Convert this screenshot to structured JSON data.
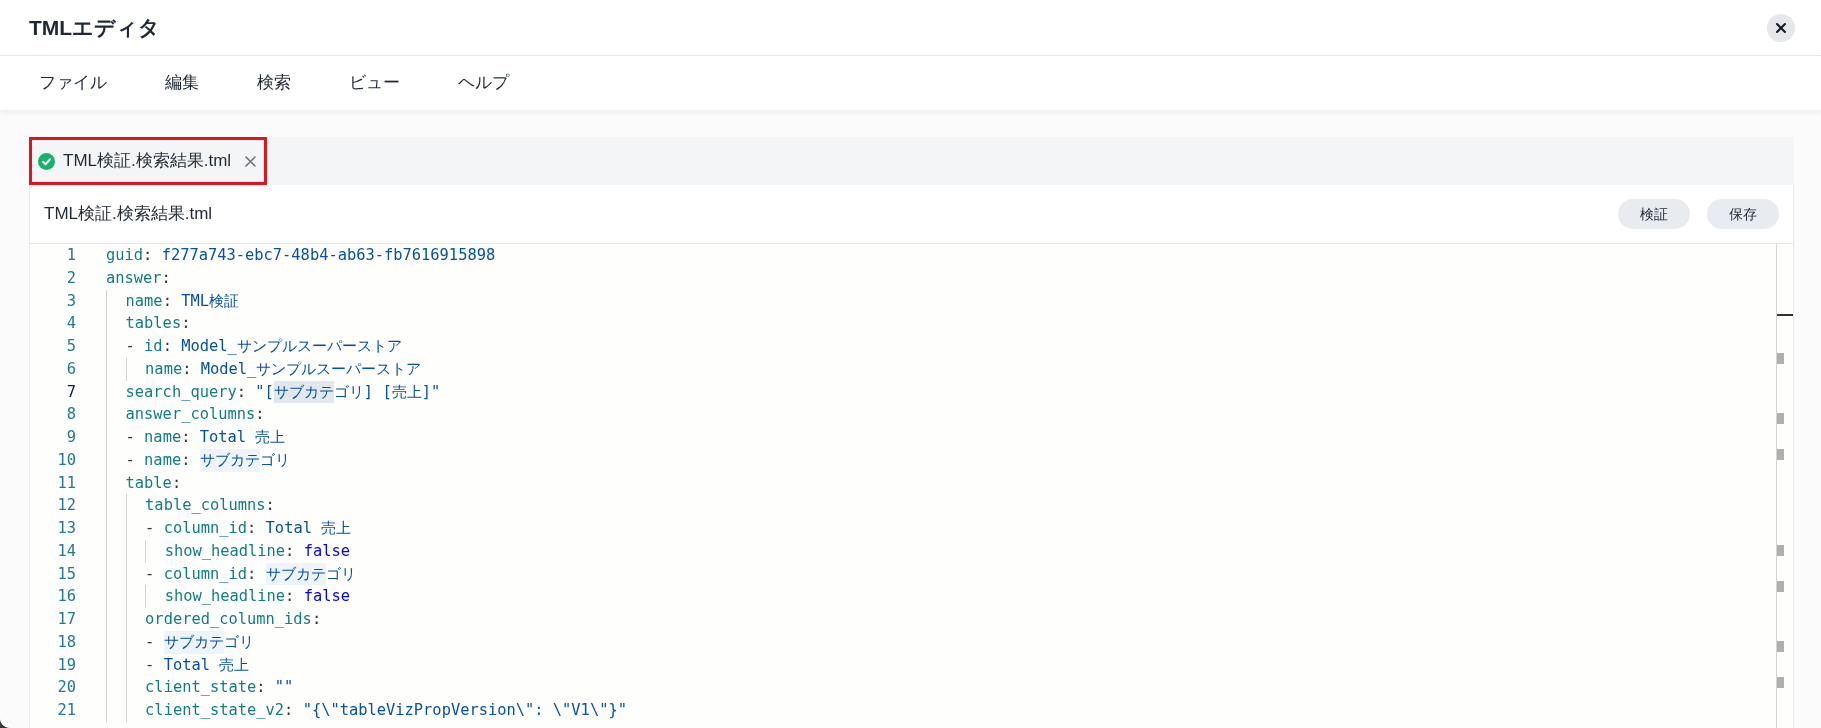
{
  "window": {
    "title": "TMLエディタ"
  },
  "menu": [
    {
      "label": "ファイル"
    },
    {
      "label": "編集"
    },
    {
      "label": "検索"
    },
    {
      "label": "ビュー"
    },
    {
      "label": "ヘルプ"
    }
  ],
  "tabs": [
    {
      "label": "TML検証.検索結果.tml",
      "valid": true,
      "selected": true,
      "outlined": true
    }
  ],
  "editor": {
    "file_name": "TML検証.検索結果.tml",
    "buttons": [
      "検証",
      "保存"
    ],
    "lines": [
      {
        "number": "1",
        "current": false,
        "parts": [
          {
            "kind": "key",
            "text": "guid"
          },
          {
            "kind": "punct",
            "text": ": "
          },
          {
            "kind": "value",
            "text": "f277a743-ebc7-48b4-ab63-fb7616915898"
          }
        ]
      },
      {
        "number": "2",
        "current": false,
        "parts": [
          {
            "kind": "key",
            "text": "answer"
          },
          {
            "kind": "punct",
            "text": ":"
          }
        ]
      },
      {
        "number": "3",
        "current": false,
        "parts": [
          {
            "kind": "key",
            "text": "  name"
          },
          {
            "kind": "punct",
            "text": ": "
          },
          {
            "kind": "value",
            "text": "TML検証"
          }
        ]
      },
      {
        "number": "4",
        "current": false,
        "parts": [
          {
            "kind": "key",
            "text": "  tables"
          },
          {
            "kind": "punct",
            "text": ":"
          }
        ]
      },
      {
        "number": "5",
        "current": false,
        "parts": [
          {
            "kind": "punct",
            "text": "  - "
          },
          {
            "kind": "key",
            "text": "id"
          },
          {
            "kind": "punct",
            "text": ": "
          },
          {
            "kind": "value",
            "text": "Model_サンプルスーパーストア"
          }
        ]
      },
      {
        "number": "6",
        "current": false,
        "parts": [
          {
            "kind": "key",
            "text": "    name"
          },
          {
            "kind": "punct",
            "text": ": "
          },
          {
            "kind": "value",
            "text": "Model_サンプルスーパーストア"
          }
        ]
      },
      {
        "number": "7",
        "current": true,
        "parts": [
          {
            "kind": "key",
            "text": "  search_query"
          },
          {
            "kind": "punct",
            "text": ": "
          },
          {
            "kind": "value",
            "text": "\"["
          },
          {
            "kind": "value",
            "text": "サブカテ",
            "highlighted": true,
            "current": true
          },
          {
            "kind": "value",
            "text": "ゴリ] [売上]\""
          }
        ]
      },
      {
        "number": "8",
        "current": false,
        "parts": [
          {
            "kind": "key",
            "text": "  answer_columns"
          },
          {
            "kind": "punct",
            "text": ":"
          }
        ]
      },
      {
        "number": "9",
        "current": false,
        "parts": [
          {
            "kind": "punct",
            "text": "  - "
          },
          {
            "kind": "key",
            "text": "name"
          },
          {
            "kind": "punct",
            "text": ": "
          },
          {
            "kind": "value",
            "text": "Total 売上"
          }
        ]
      },
      {
        "number": "10",
        "current": false,
        "parts": [
          {
            "kind": "punct",
            "text": "  - "
          },
          {
            "kind": "key",
            "text": "name"
          },
          {
            "kind": "punct",
            "text": ": "
          },
          {
            "kind": "value",
            "text": "サブカテ",
            "highlighted": true,
            "current": false
          },
          {
            "kind": "value",
            "text": "ゴリ"
          }
        ]
      },
      {
        "number": "11",
        "current": false,
        "parts": [
          {
            "kind": "key",
            "text": "  table"
          },
          {
            "kind": "punct",
            "text": ":"
          }
        ]
      },
      {
        "number": "12",
        "current": false,
        "parts": [
          {
            "kind": "key",
            "text": "    table_columns"
          },
          {
            "kind": "punct",
            "text": ":"
          }
        ]
      },
      {
        "number": "13",
        "current": false,
        "parts": [
          {
            "kind": "punct",
            "text": "    - "
          },
          {
            "kind": "key",
            "text": "column_id"
          },
          {
            "kind": "punct",
            "text": ": "
          },
          {
            "kind": "value",
            "text": "Total 売上"
          }
        ]
      },
      {
        "number": "14",
        "current": false,
        "parts": [
          {
            "kind": "key",
            "text": "      show_headline"
          },
          {
            "kind": "punct",
            "text": ": "
          },
          {
            "kind": "keyword",
            "text": "false"
          }
        ]
      },
      {
        "number": "15",
        "current": false,
        "parts": [
          {
            "kind": "punct",
            "text": "    - "
          },
          {
            "kind": "key",
            "text": "column_id"
          },
          {
            "kind": "punct",
            "text": ": "
          },
          {
            "kind": "value",
            "text": "サブカテ",
            "highlighted": true,
            "current": false
          },
          {
            "kind": "value",
            "text": "ゴリ"
          }
        ]
      },
      {
        "number": "16",
        "current": false,
        "parts": [
          {
            "kind": "key",
            "text": "      show_headline"
          },
          {
            "kind": "punct",
            "text": ": "
          },
          {
            "kind": "keyword",
            "text": "false"
          }
        ]
      },
      {
        "number": "17",
        "current": false,
        "parts": [
          {
            "kind": "key",
            "text": "    ordered_column_ids"
          },
          {
            "kind": "punct",
            "text": ":"
          }
        ]
      },
      {
        "number": "18",
        "current": false,
        "parts": [
          {
            "kind": "punct",
            "text": "    - "
          },
          {
            "kind": "value",
            "text": "サブカテ",
            "highlighted": true,
            "current": false
          },
          {
            "kind": "value",
            "text": "ゴリ"
          }
        ]
      },
      {
        "number": "19",
        "current": false,
        "parts": [
          {
            "kind": "punct",
            "text": "    - "
          },
          {
            "kind": "value",
            "text": "Total 売上"
          }
        ]
      },
      {
        "number": "20",
        "current": false,
        "parts": [
          {
            "kind": "key",
            "text": "    client_state"
          },
          {
            "kind": "punct",
            "text": ": "
          },
          {
            "kind": "value",
            "text": "\"\""
          }
        ]
      },
      {
        "number": "21",
        "current": false,
        "parts": [
          {
            "kind": "key",
            "text": "    client_state_v2"
          },
          {
            "kind": "punct",
            "text": ": "
          },
          {
            "kind": "value",
            "text": "\"{\\\"tableVizPropVersion\\\": \\\"V1\\\"}\""
          }
        ]
      }
    ]
  }
}
